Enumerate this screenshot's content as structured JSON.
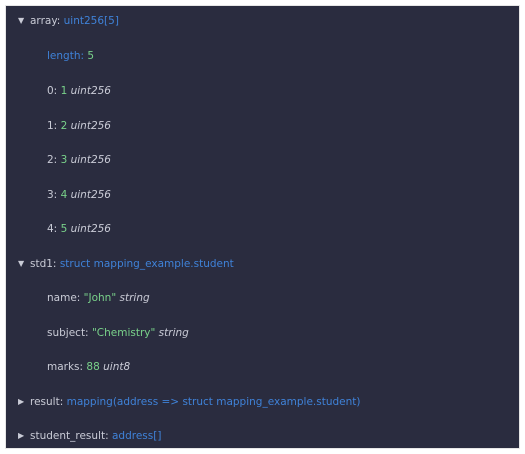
{
  "tree": {
    "array": {
      "arrow": "▼",
      "key": "array:",
      "type": "uint256[5]",
      "length": {
        "key": "length:",
        "value": "5"
      },
      "items": [
        {
          "key": "0:",
          "value": "1",
          "type": "uint256"
        },
        {
          "key": "1:",
          "value": "2",
          "type": "uint256"
        },
        {
          "key": "2:",
          "value": "3",
          "type": "uint256"
        },
        {
          "key": "3:",
          "value": "4",
          "type": "uint256"
        },
        {
          "key": "4:",
          "value": "5",
          "type": "uint256"
        }
      ]
    },
    "std1": {
      "arrow": "▼",
      "key": "std1:",
      "type": "struct mapping_example.student",
      "fields": [
        {
          "key": "name:",
          "value": "\"John\"",
          "type": "string"
        },
        {
          "key": "subject:",
          "value": "\"Chemistry\"",
          "type": "string"
        },
        {
          "key": "marks:",
          "value": "88",
          "type": "uint8"
        }
      ]
    },
    "result": {
      "arrow": "▶",
      "key": "result:",
      "type": "mapping(address => struct mapping_example.student)"
    },
    "student_result": {
      "arrow": "▶",
      "key": "student_result:",
      "type": "address[]"
    }
  }
}
